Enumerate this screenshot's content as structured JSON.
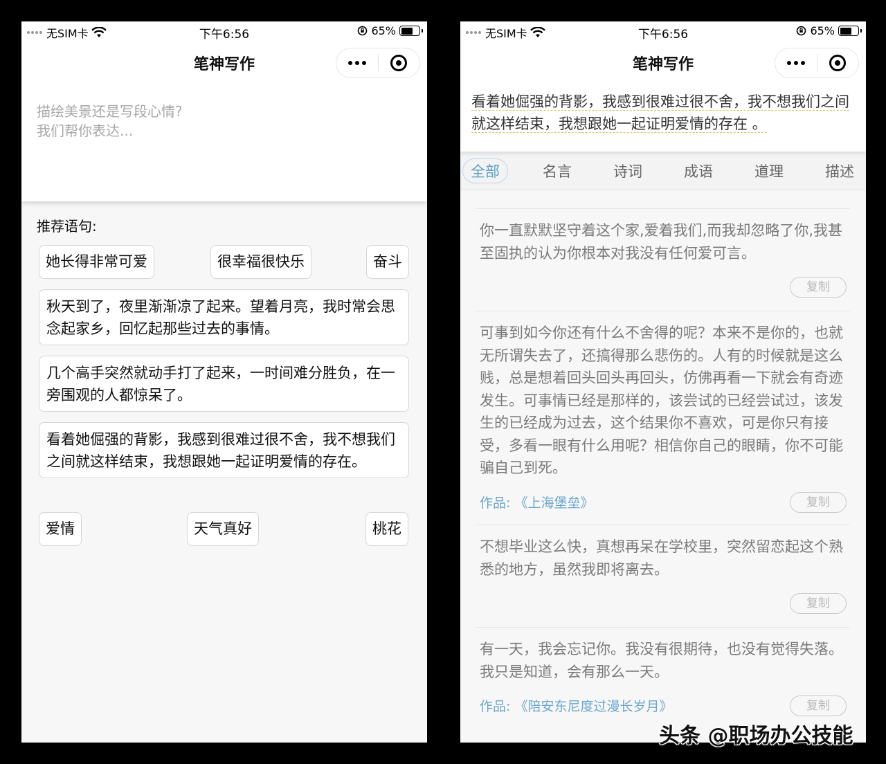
{
  "status": {
    "carrier": "无SIM卡",
    "time": "下午6:56",
    "battery": "65%",
    "battery_level": 0.65
  },
  "navbar": {
    "title": "笔神写作"
  },
  "left": {
    "placeholder": "描绘美景还是写段心情?\n我们帮你表达...",
    "rec_title": "推荐语句:",
    "chips_row1": [
      "她长得非常可爱",
      "很幸福很快乐",
      "奋斗"
    ],
    "cards": [
      "秋天到了，夜里渐渐凉了起来。望着月亮，我时常会思念起家乡，回忆起那些过去的事情。",
      "几个高手突然就动手打了起来，一时间难分胜负，在一旁围观的人都惊呆了。",
      "看着她倔强的背影，我感到很难过很不舍，我不想我们之间就这样结束，我想跟她一起证明爱情的存在。"
    ],
    "chips_row2": [
      "爱情",
      "天气真好",
      "桃花"
    ]
  },
  "right": {
    "selected_text": "看着她倔强的背影，我感到很难过很不舍，我不想我们之间就这样结束，我想跟她一起证明爱情的存在 。",
    "tabs": [
      "全部",
      "名言",
      "诗词",
      "成语",
      "道理",
      "描述"
    ],
    "copy_label": "复制",
    "source_label": "作品:",
    "quotes": [
      {
        "text": "你一直默默坚守着这个家,爱着我们,而我却忽略了你,我甚至固执的认为你根本对我没有任何爱可言。",
        "source": ""
      },
      {
        "text": "可事到如今你还有什么不舍得的呢？本来不是你的，也就无所谓失去了，还搞得那么悲伤的。人有的时候就是这么贱，总是想着回头回头再回头，仿佛再看一下就会有奇迹发生。可事情已经是那样的，该尝试的已经尝试过，该发生的已经成为过去，这个结果你不喜欢，可是你只有接受，多看一眼有什么用呢？相信你自己的眼睛，你不可能骗自己到死。",
        "source": "《上海堡垒》"
      },
      {
        "text": "不想毕业这么快，真想再呆在学校里，突然留恋起这个熟悉的地方，虽然我即将离去。",
        "source": ""
      },
      {
        "text": "有一天，我会忘记你。我没有很期待，也没有觉得失落。我只是知道，会有那么一天。",
        "source": "《陪安东尼度过漫长岁月》"
      }
    ]
  },
  "watermark": "头条 @职场办公技能"
}
